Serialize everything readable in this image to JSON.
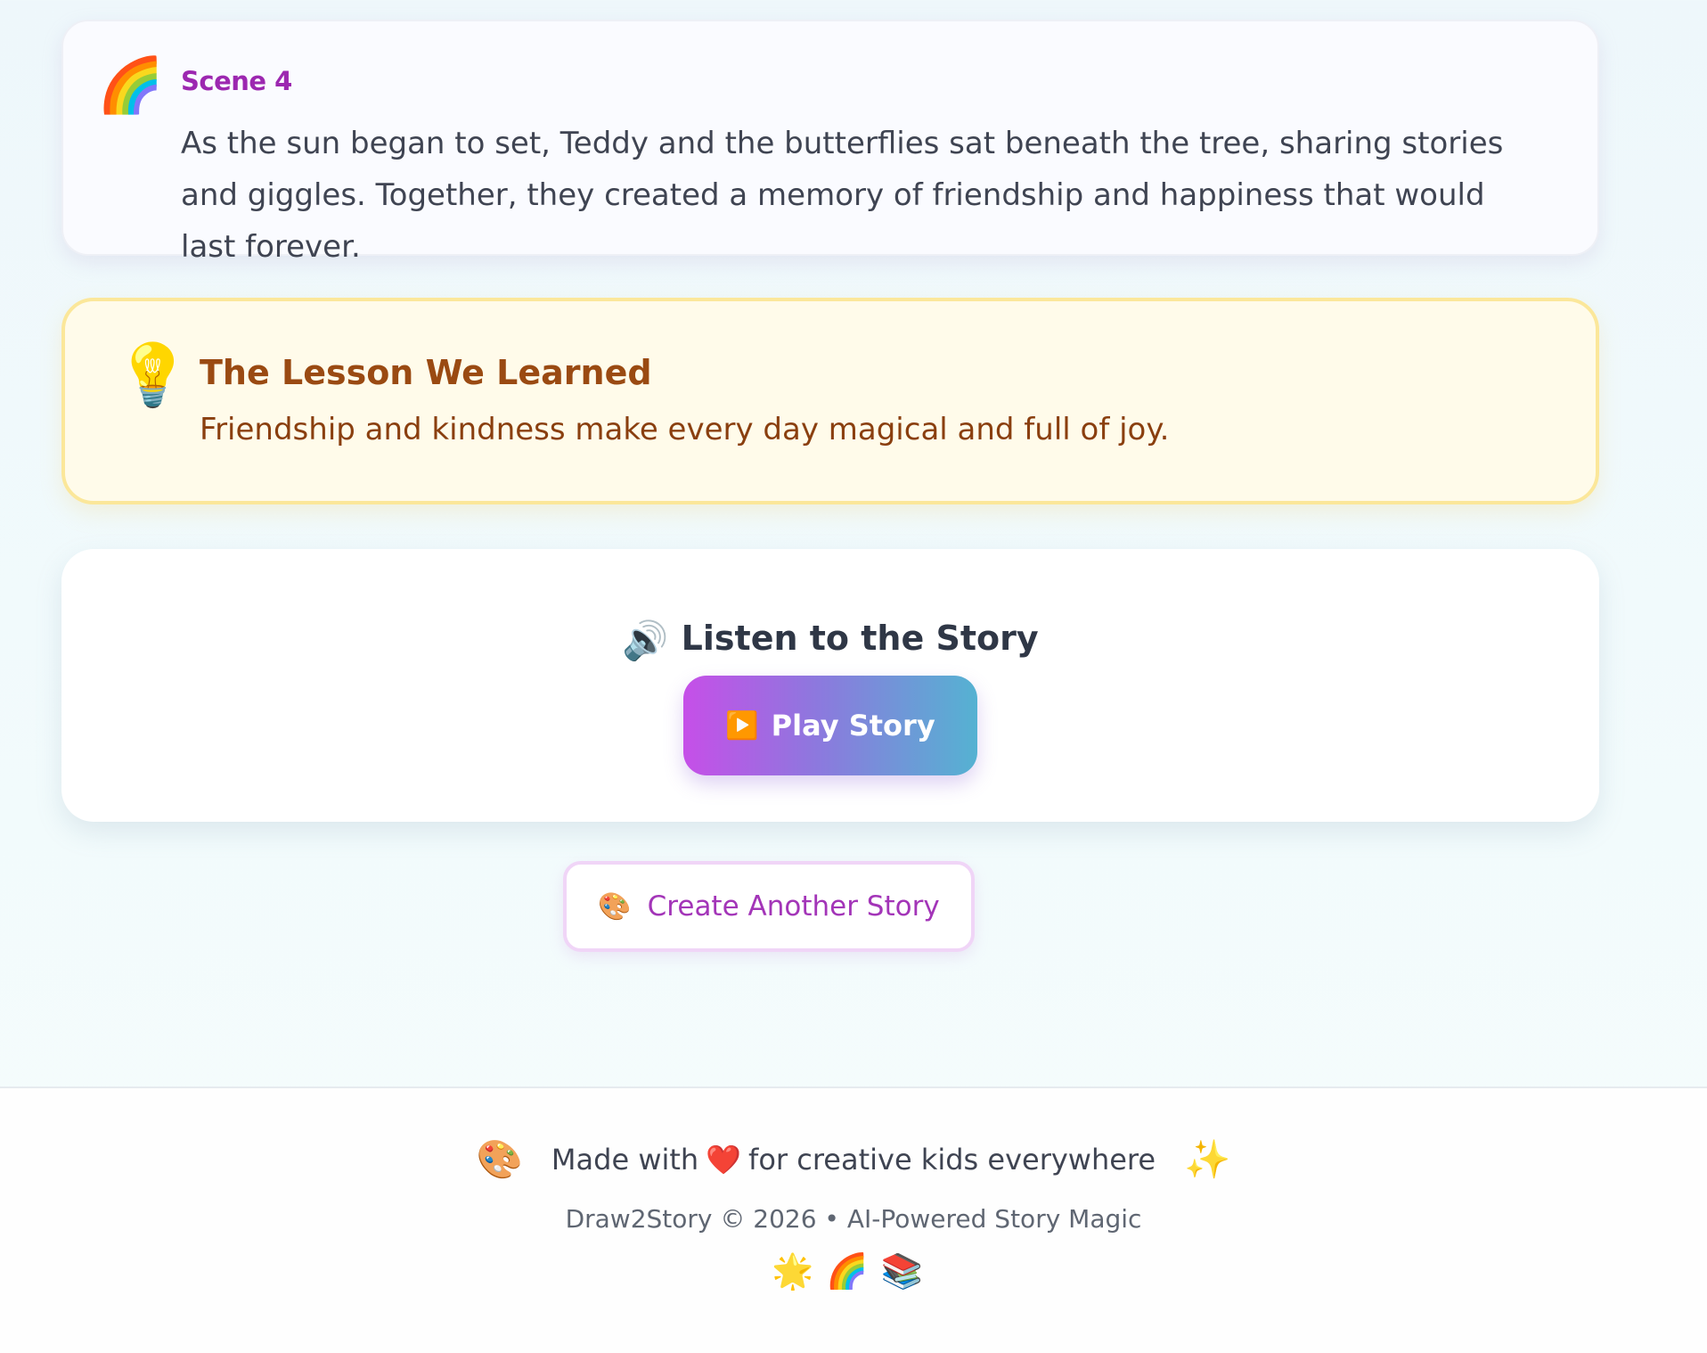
{
  "scene": {
    "icon": "🌈",
    "title": "Scene 4",
    "text": "As the sun began to set, Teddy and the butterflies sat beneath the tree, sharing stories and giggles. Together, they created a memory of friendship and happiness that would last forever."
  },
  "lesson": {
    "icon": "💡",
    "title": "The Lesson We Learned",
    "text": "Friendship and kindness make every day magical and full of joy."
  },
  "audio": {
    "icon": "🔊",
    "heading": "Listen to the Story",
    "play_icon": "▶️",
    "play_label": "Play Story"
  },
  "create": {
    "icon": "🎨",
    "label": "Create Another Story"
  },
  "footer": {
    "left_icon": "🎨",
    "made_with_prefix": "Made with",
    "heart": "❤️",
    "made_with_suffix": "for creative kids everywhere",
    "right_icon": "✨",
    "copyright": "Draw2Story © 2026 • AI-Powered Story Magic",
    "icons": [
      "🌟",
      "🌈",
      "📚"
    ]
  },
  "colors": {
    "scene_title": "#9c27b0",
    "lesson_bg": "#fffbea",
    "lesson_border": "#fbe79a",
    "lesson_text": "#8a3f0f",
    "play_gradient_start": "#c64fe8",
    "play_gradient_end": "#55b2d2",
    "create_text": "#a335b8"
  }
}
